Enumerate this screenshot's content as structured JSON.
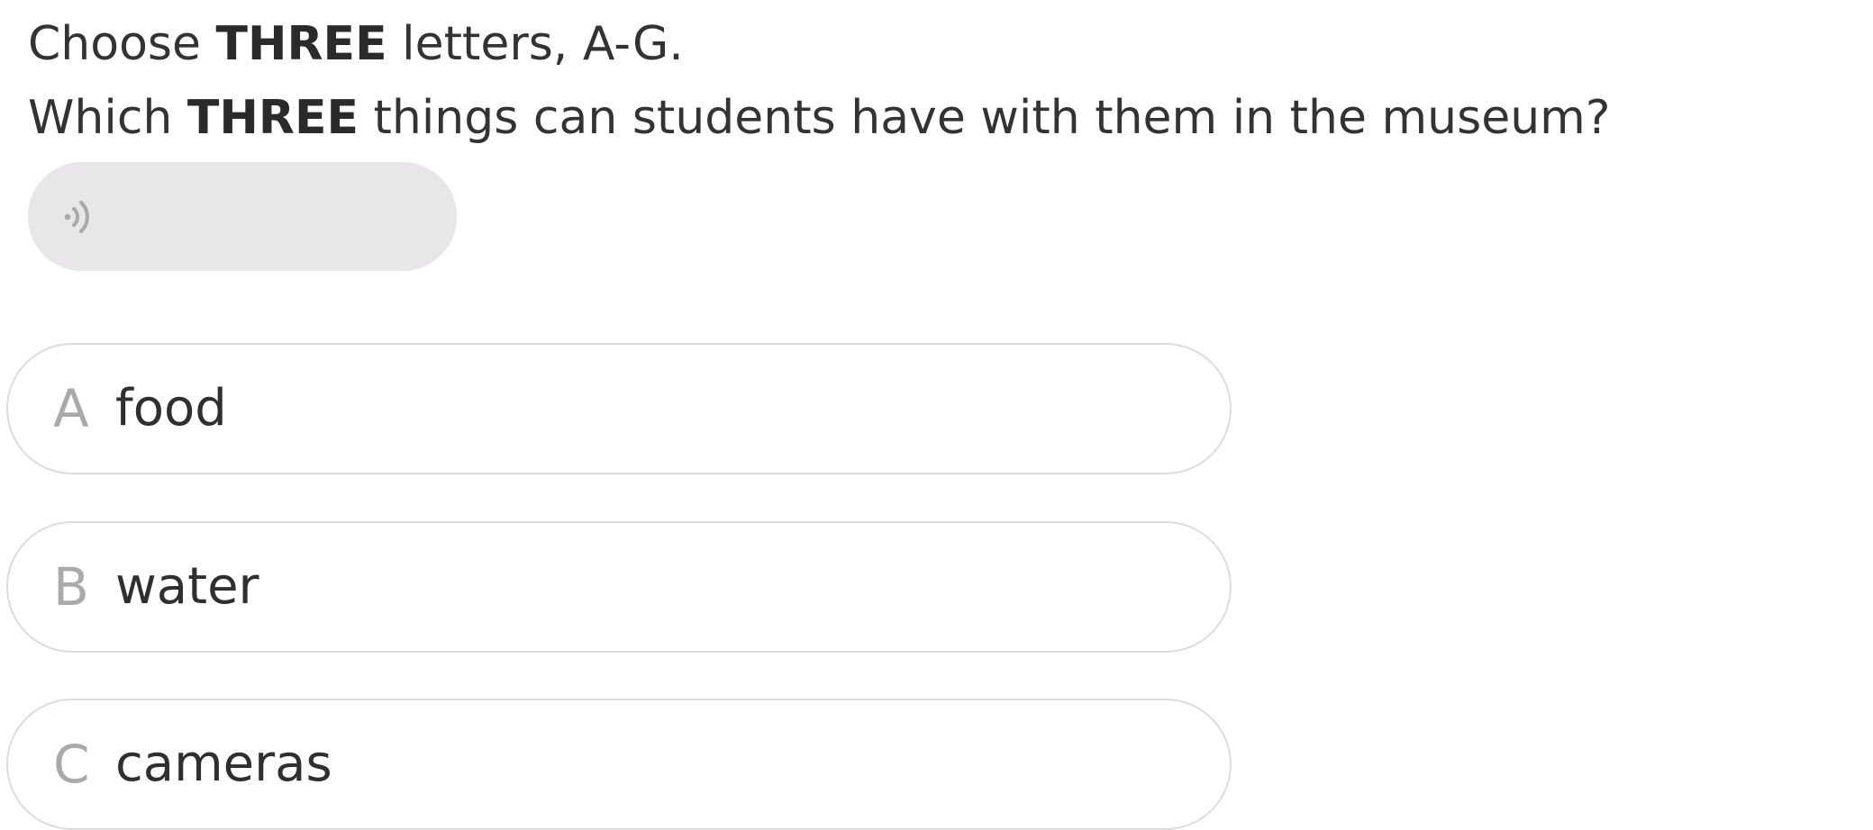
{
  "instructions": {
    "line1": {
      "prefix": "Choose ",
      "emphasis": "THREE",
      "suffix": " letters, A-G."
    },
    "line2": {
      "prefix": "Which ",
      "emphasis": "THREE",
      "suffix": " things can students have with them in the museum?"
    }
  },
  "audio": {
    "icon": "speaker-icon"
  },
  "options": [
    {
      "letter": "A",
      "text": "food"
    },
    {
      "letter": "B",
      "text": "water"
    },
    {
      "letter": "C",
      "text": "cameras"
    }
  ]
}
